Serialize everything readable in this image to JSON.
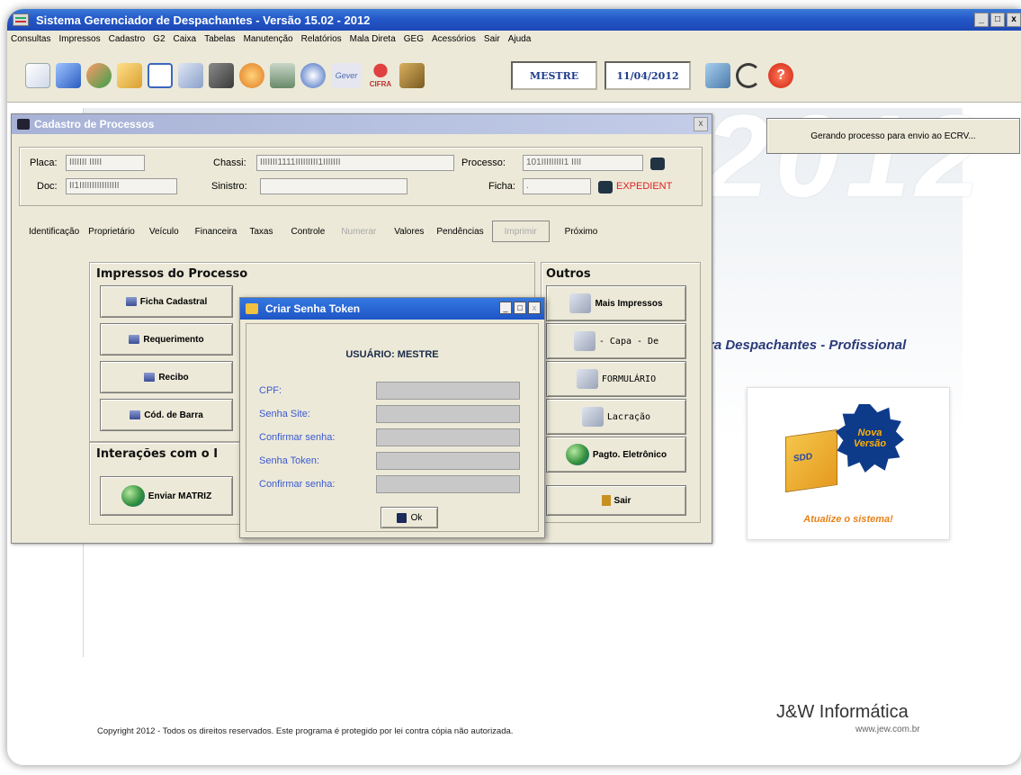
{
  "app": {
    "title": "Sistema Gerenciador de Despachantes - Versão 15.02 - 2012",
    "win_min": "_",
    "win_max": "□",
    "win_close": "x"
  },
  "menu": [
    "Consultas",
    "Impressos",
    "Cadastro",
    "G2",
    "Caixa",
    "Tabelas",
    "Manutenção",
    "Relatórios",
    "Mala Direta",
    "GEG",
    "Acessórios",
    "Sair",
    "Ajuda"
  ],
  "toolbar": {
    "user": "MESTRE",
    "date": "11/04/2012",
    "icon_names": [
      "new-document-icon",
      "car-icon",
      "users-icon",
      "folder-icon",
      "window-icon",
      "documents-icon",
      "printer-icon",
      "calendar-icon",
      "calculator-icon",
      "disc-icon",
      "gever-icon",
      "cifra-icon",
      "scroll-icon",
      "monitor-icon",
      "phone-icon",
      "help-icon"
    ],
    "gever_label": "Gever",
    "cifra_label": "CIFRA"
  },
  "background": {
    "year": "2012",
    "slogan": "ra Despachantes - Profissional",
    "status_box": "Gerando processo para envio ao ECRV...",
    "promo_new_line1": "Nova",
    "promo_new_line2": "Versão",
    "promo_update": "Atualize o sistema!",
    "brand": "J&W Informática",
    "brand_url": "www.jew.com.br",
    "copyright": "Copyright 2012 - Todos os direitos reservados. Este programa é protegido por lei contra cópia não autorizada."
  },
  "cadastro": {
    "title": "Cadastro de Processos",
    "close": "x",
    "fields": {
      "placa_label": "Placa:",
      "placa_value": "IIIIIII IIIII",
      "chassi_label": "Chassi:",
      "chassi_value": "IIIIIII1111IIIIIIIII1IIIIIII",
      "processo_label": "Processo:",
      "processo_value": "101IIIIIIIII1 IIII",
      "doc_label": "Doc:",
      "doc_value": "II1IIIIIIIIIIIIIIII",
      "sinistro_label": "Sinistro:",
      "sinistro_value": "",
      "ficha_label": "Ficha:",
      "ficha_value": ".",
      "expedient": "EXPEDIENT"
    },
    "tabs": [
      {
        "label": "Identificação",
        "state": "normal"
      },
      {
        "label": "Proprietário",
        "state": "normal"
      },
      {
        "label": "Veículo",
        "state": "normal"
      },
      {
        "label": "Financeira",
        "state": "normal"
      },
      {
        "label": "Taxas",
        "state": "normal"
      },
      {
        "label": "Controle",
        "state": "normal"
      },
      {
        "label": "Numerar",
        "state": "disabled"
      },
      {
        "label": "Valores",
        "state": "normal"
      },
      {
        "label": "Pendências",
        "state": "normal"
      },
      {
        "label": "Imprimir",
        "state": "disabled"
      },
      {
        "label": "Próximo",
        "state": "normal"
      }
    ],
    "impressos_title": "Impressos do Processo",
    "impressos_buttons": [
      "Ficha Cadastral",
      "Requerimento",
      "Recibo",
      "Cód. de Barra"
    ],
    "interacoes_title": "Interações com o I",
    "enviar_button": "Enviar MATRIZ",
    "outros_title": "Outros",
    "outros_buttons": [
      "Mais Impressos",
      "- Capa - De",
      "FORMULÁRIO",
      "Lacração",
      "Pagto. Eletrônico"
    ],
    "sair_button": "Sair"
  },
  "token": {
    "title": "Criar Senha Token",
    "user_line": "USUÁRIO: MESTRE",
    "labels": [
      "CPF:",
      "Senha Site:",
      "Confirmar senha:",
      "Senha Token:",
      "Confirmar senha:"
    ],
    "ok_button": "Ok",
    "btn_min": "_",
    "btn_max": "□",
    "btn_close": "x"
  }
}
